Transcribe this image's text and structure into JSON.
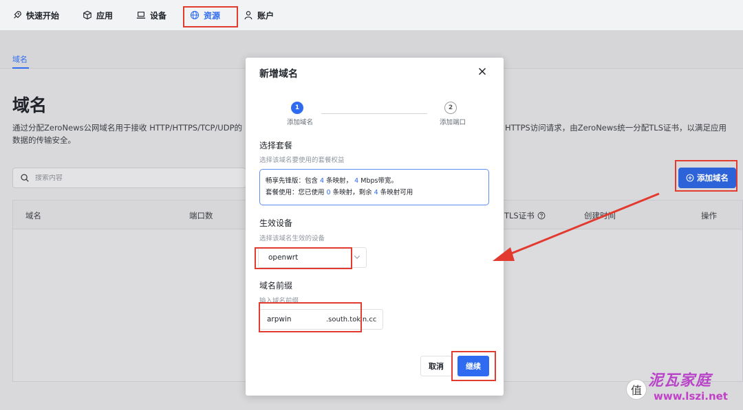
{
  "nav": {
    "items": [
      {
        "label": "快速开始",
        "icon": "rocket-icon"
      },
      {
        "label": "应用",
        "icon": "cube-icon"
      },
      {
        "label": "设备",
        "icon": "laptop-icon"
      },
      {
        "label": "资源",
        "icon": "globe-icon",
        "active": true
      },
      {
        "label": "账户",
        "icon": "user-icon"
      }
    ]
  },
  "subtabs": [
    "域名"
  ],
  "page": {
    "title": "域名",
    "description_left": "通过分配ZeroNews公网域名用于接收 HTTP/HTTPS/TCP/UDP的",
    "description_left_2": "数据的传输安全。",
    "description_right": "HTTPS访问请求，由ZeroNews统一分配TLS证书，以满足应用",
    "search_placeholder": "搜索内容",
    "add_button": "添加域名",
    "columns": [
      "域名",
      "端口数",
      "TLS证书",
      "创建时间",
      "操作"
    ]
  },
  "modal": {
    "title": "新增域名",
    "steps": [
      {
        "num": "1",
        "label": "添加域名"
      },
      {
        "num": "2",
        "label": "添加端口"
      }
    ],
    "plan": {
      "title": "选择套餐",
      "hint": "选择该域名要使用的套餐权益",
      "line1_a": "畅享先锋版：包含",
      "line1_n1": "4",
      "line1_b": "条映射，",
      "line1_n2": "4",
      "line1_c": "Mbps带宽。",
      "line2_a": "套餐使用：您已使用",
      "line2_n1": "0",
      "line2_b": "条映射，剩余",
      "line2_n2": "4",
      "line2_c": "条映射可用"
    },
    "device": {
      "title": "生效设备",
      "hint": "选择该域名生效的设备",
      "value": "openwrt"
    },
    "prefix": {
      "title": "域名前缀",
      "hint": "输入域名前缀",
      "value": "arpwin",
      "suffix": ".south.tokin.cc"
    },
    "cancel": "取消",
    "continue": "继续"
  },
  "watermark": {
    "text": "泥瓦家庭",
    "url": "www.lszi.net",
    "badge": "值"
  },
  "colors": {
    "accent": "#2f6bf1",
    "annotation_red": "#e23a2f"
  }
}
